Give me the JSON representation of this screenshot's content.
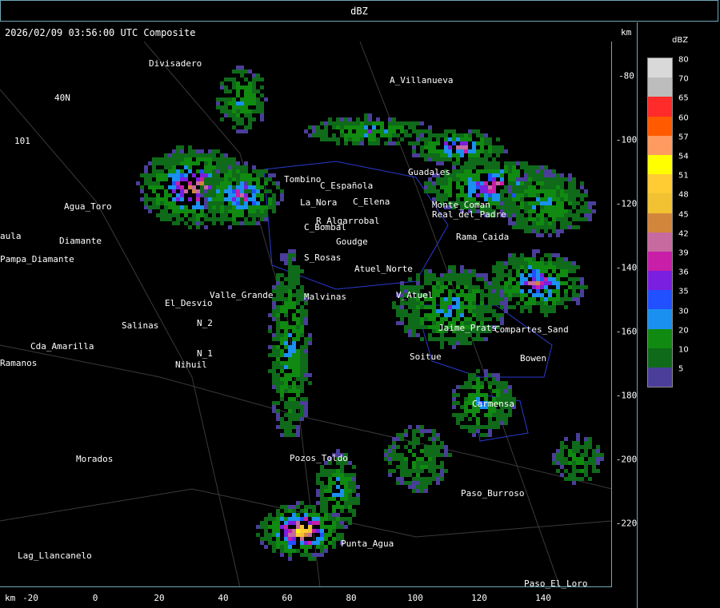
{
  "header": {
    "product_label": "dBZ",
    "timestamp_title": "2026/02/09 03:56:00 UTC Composite",
    "km_unit_top": "km",
    "km_unit_bottom": "km"
  },
  "x_axis_ticks": [
    "-20",
    "0",
    "20",
    "40",
    "60",
    "80",
    "100",
    "120",
    "140"
  ],
  "y_axis_ticks": [
    "-80",
    "-100",
    "-120",
    "-140",
    "-160",
    "-180",
    "-200",
    "-220"
  ],
  "legend": {
    "title": "dBZ",
    "levels": [
      {
        "value": "80",
        "color": "#d9d9d9"
      },
      {
        "value": "70",
        "color": "#bdbdbd"
      },
      {
        "value": "65",
        "color": "#ff2a2a"
      },
      {
        "value": "60",
        "color": "#ff5a00"
      },
      {
        "value": "57",
        "color": "#ff9a60"
      },
      {
        "value": "54",
        "color": "#ffff00"
      },
      {
        "value": "51",
        "color": "#ffcc33"
      },
      {
        "value": "48",
        "color": "#f2c233"
      },
      {
        "value": "45",
        "color": "#d2863c"
      },
      {
        "value": "42",
        "color": "#c66aa0"
      },
      {
        "value": "39",
        "color": "#c81ea8"
      },
      {
        "value": "36",
        "color": "#7a1ee0"
      },
      {
        "value": "35",
        "color": "#2050ff"
      },
      {
        "value": "30",
        "color": "#1a90f0"
      },
      {
        "value": "20",
        "color": "#108a10"
      },
      {
        "value": "10",
        "color": "#0f6a1a"
      },
      {
        "value": "5",
        "color": "#4a3e9a"
      }
    ]
  },
  "places": [
    {
      "name": "Divisadero"
    },
    {
      "name": "A_Villanueva"
    },
    {
      "name": "40N"
    },
    {
      "name": "101"
    },
    {
      "name": "Agua_Toro"
    },
    {
      "name": "Diamante"
    },
    {
      "name": "Pampa_Diamante"
    },
    {
      "name": "El_Desvio"
    },
    {
      "name": "Salinas"
    },
    {
      "name": "Cda_Amarilla"
    },
    {
      "name": "Nihuil"
    },
    {
      "name": "Valle_Grande"
    },
    {
      "name": "La_Nora"
    },
    {
      "name": "C_Española"
    },
    {
      "name": "C_Elena"
    },
    {
      "name": "S_Rosas"
    },
    {
      "name": "Atuel_Norte"
    },
    {
      "name": "Malvinas"
    },
    {
      "name": "V_Atuel"
    },
    {
      "name": "Real_del_Padre"
    },
    {
      "name": "Jaime_Prats"
    },
    {
      "name": "Compartes_Sand"
    },
    {
      "name": "Bowen"
    },
    {
      "name": "Carmensa"
    },
    {
      "name": "Morados"
    },
    {
      "name": "Paso_Burroso"
    },
    {
      "name": "Punta_Agua"
    },
    {
      "name": "Lag_Llancanelo"
    },
    {
      "name": "Paso_El_Loro"
    },
    {
      "name": "Guadales"
    },
    {
      "name": "Monte_Coman"
    },
    {
      "name": "Soitue"
    },
    {
      "name": "Pozos_Toldo"
    },
    {
      "name": "N_1"
    },
    {
      "name": "N_2"
    },
    {
      "name": "Ramanos"
    },
    {
      "name": "aula"
    },
    {
      "name": "Tombino"
    },
    {
      "name": "Goudge"
    },
    {
      "name": "C_Bombal"
    },
    {
      "name": "R_Algarrobal"
    },
    {
      "name": "Rama_Caida"
    }
  ]
}
